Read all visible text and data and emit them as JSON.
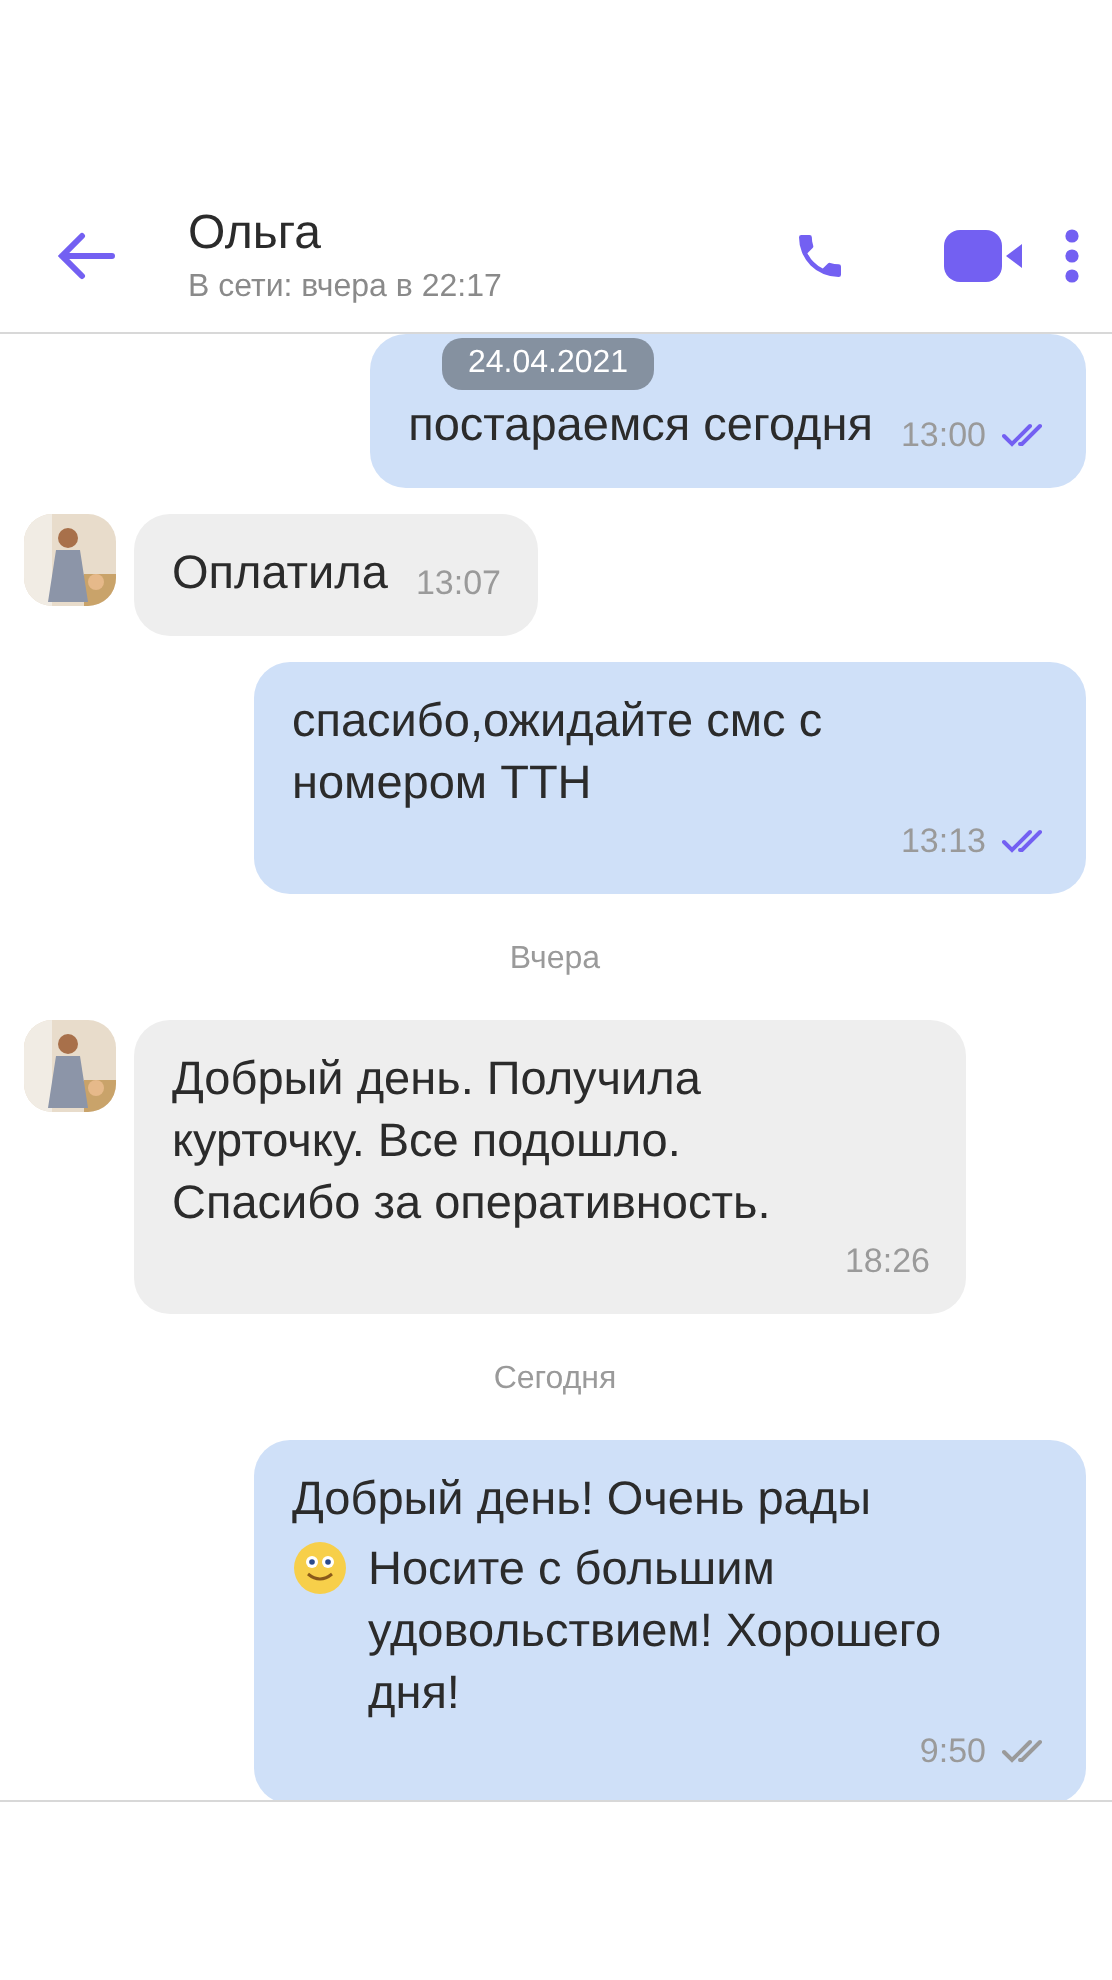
{
  "header": {
    "name": "Ольга",
    "status": "В сети: вчера в 22:17"
  },
  "date_pill": "24.04.2021",
  "feed": [
    {
      "kind": "message",
      "outgoing": true,
      "paragraphs": [
        {
          "text": "постараемся сегодня",
          "emoji": false
        }
      ],
      "time": "13:00",
      "read": true
    },
    {
      "kind": "message",
      "outgoing": false,
      "paragraphs": [
        {
          "text": "Оплатила",
          "emoji": false
        }
      ],
      "time": "13:07"
    },
    {
      "kind": "message",
      "outgoing": true,
      "paragraphs": [
        {
          "text": "спасибо,ожидайте смс с номером ТТН",
          "emoji": false
        }
      ],
      "time": "13:13",
      "read": true
    },
    {
      "kind": "day",
      "label": "Вчера"
    },
    {
      "kind": "message",
      "outgoing": false,
      "paragraphs": [
        {
          "text": "Добрый день. Получила курточку. Все подошло. Спасибо за оперативность.",
          "emoji": false
        }
      ],
      "time": "18:26"
    },
    {
      "kind": "day",
      "label": "Сегодня"
    },
    {
      "kind": "message",
      "outgoing": true,
      "paragraphs": [
        {
          "text": "Добрый день! Очень рады",
          "emoji": false
        },
        {
          "text": "Носите с большим удовольствием! Хорошего дня!",
          "emoji": true
        }
      ],
      "time": "9:50",
      "read": false
    }
  ]
}
